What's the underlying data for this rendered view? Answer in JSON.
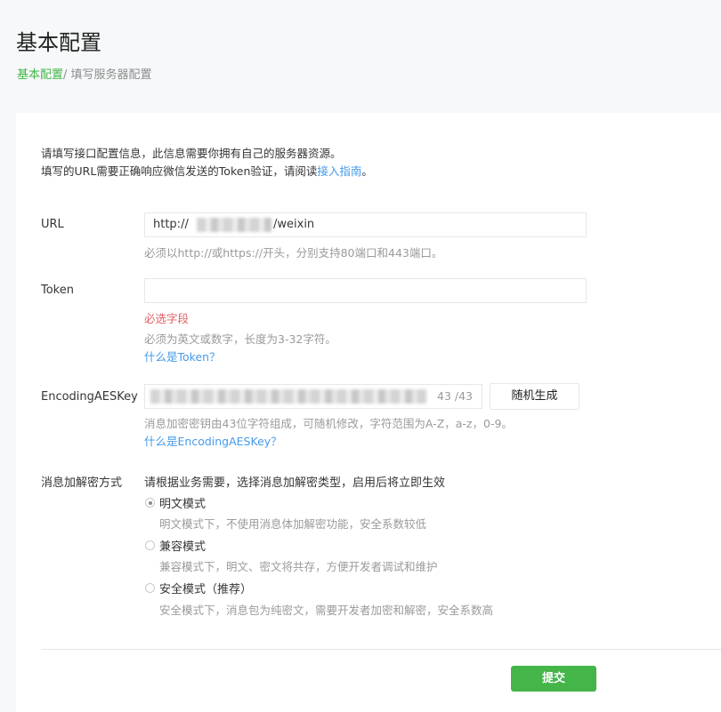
{
  "header": {
    "title": "基本配置",
    "breadcrumb": {
      "link": "基本配置",
      "separator": "/ ",
      "current": "填写服务器配置"
    }
  },
  "intro": {
    "line1": "请填写接口配置信息，此信息需要你拥有自己的服务器资源。",
    "line2_prefix": "填写的URL需要正确响应微信发送的Token验证，请阅读",
    "line2_link": "接入指南",
    "line2_suffix": "。"
  },
  "url": {
    "label": "URL",
    "value_prefix": "http://",
    "value_suffix": "/weixin",
    "hint": "必须以http://或https://开头，分别支持80端口和443端口。"
  },
  "token": {
    "label": "Token",
    "value": "",
    "required": "必选字段",
    "hint": "必须为英文或数字，长度为3-32字符。",
    "link": "什么是Token？"
  },
  "aes": {
    "label": "EncodingAESKey",
    "counter": "43 /43",
    "generate_button": "随机生成",
    "hint": "消息加密密钥由43位字符组成，可随机修改，字符范围为A-Z，a-z，0-9。",
    "link": "什么是EncodingAESKey？"
  },
  "encryption": {
    "label": "消息加解密方式",
    "intro": "请根据业务需要，选择消息加解密类型，启用后将立即生效",
    "options": [
      {
        "label": "明文模式",
        "desc": "明文模式下，不使用消息体加解密功能，安全系数较低",
        "checked": true
      },
      {
        "label": "兼容模式",
        "desc": "兼容模式下，明文、密文将共存，方便开发者调试和维护",
        "checked": false
      },
      {
        "label": "安全模式（推荐）",
        "desc": "安全模式下，消息包为纯密文，需要开发者加密和解密，安全系数高",
        "checked": false
      }
    ]
  },
  "submit_label": "提交",
  "colors": {
    "accent": "#44b549",
    "link": "#459ae9",
    "error": "#e15f63"
  }
}
